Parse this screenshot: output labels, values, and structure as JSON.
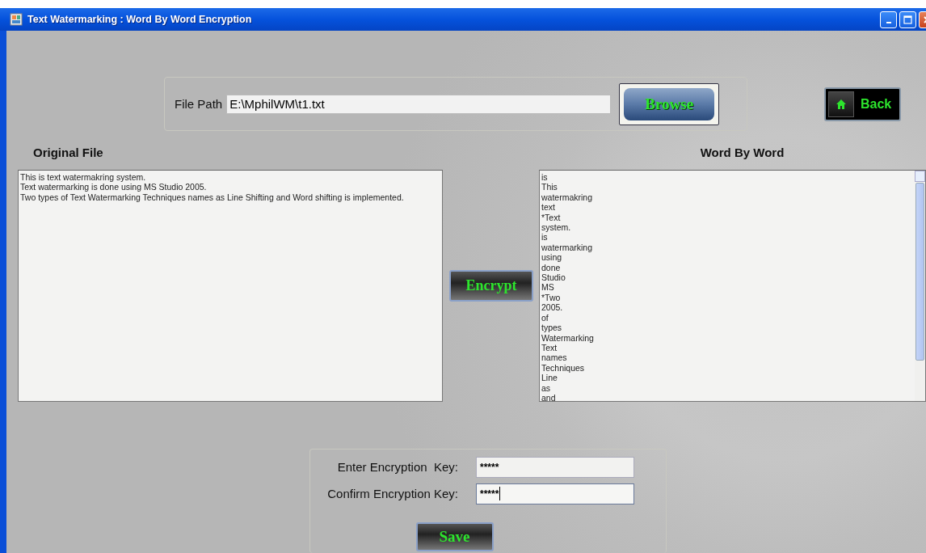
{
  "window": {
    "title": "Text Watermarking : Word By Word Encryption"
  },
  "file_path": {
    "label": "File Path",
    "value": "E:\\MphilWM\\t1.txt"
  },
  "browse_button": {
    "label": "Browse"
  },
  "back_button": {
    "label": "Back"
  },
  "original_file": {
    "heading": "Original File",
    "lines": [
      "This is text watermakring system.",
      "Text watermarking is done using MS Studio 2005.",
      "Two types of Text Watermarking Techniques names as Line Shifting and Word shifting is implemented."
    ]
  },
  "encrypt_button": {
    "label": "Encrypt"
  },
  "word_by_word": {
    "heading": "Word By Word",
    "words": [
      "is",
      "This",
      "watermakring",
      "text",
      "*Text",
      "system.",
      "is",
      "watermarking",
      "using",
      "done",
      "Studio",
      "MS",
      "*Two",
      "2005.",
      "of",
      "types",
      "Watermarking",
      "Text",
      "names",
      "Techniques",
      "Line",
      "as",
      "and"
    ]
  },
  "key_form": {
    "fields": [
      {
        "label": "Enter Encryption  Key:",
        "value": "*****",
        "focused": false
      },
      {
        "label": "Confirm Encryption Key:",
        "value": "*****",
        "focused": true
      }
    ],
    "save_button": {
      "label": "Save"
    }
  }
}
